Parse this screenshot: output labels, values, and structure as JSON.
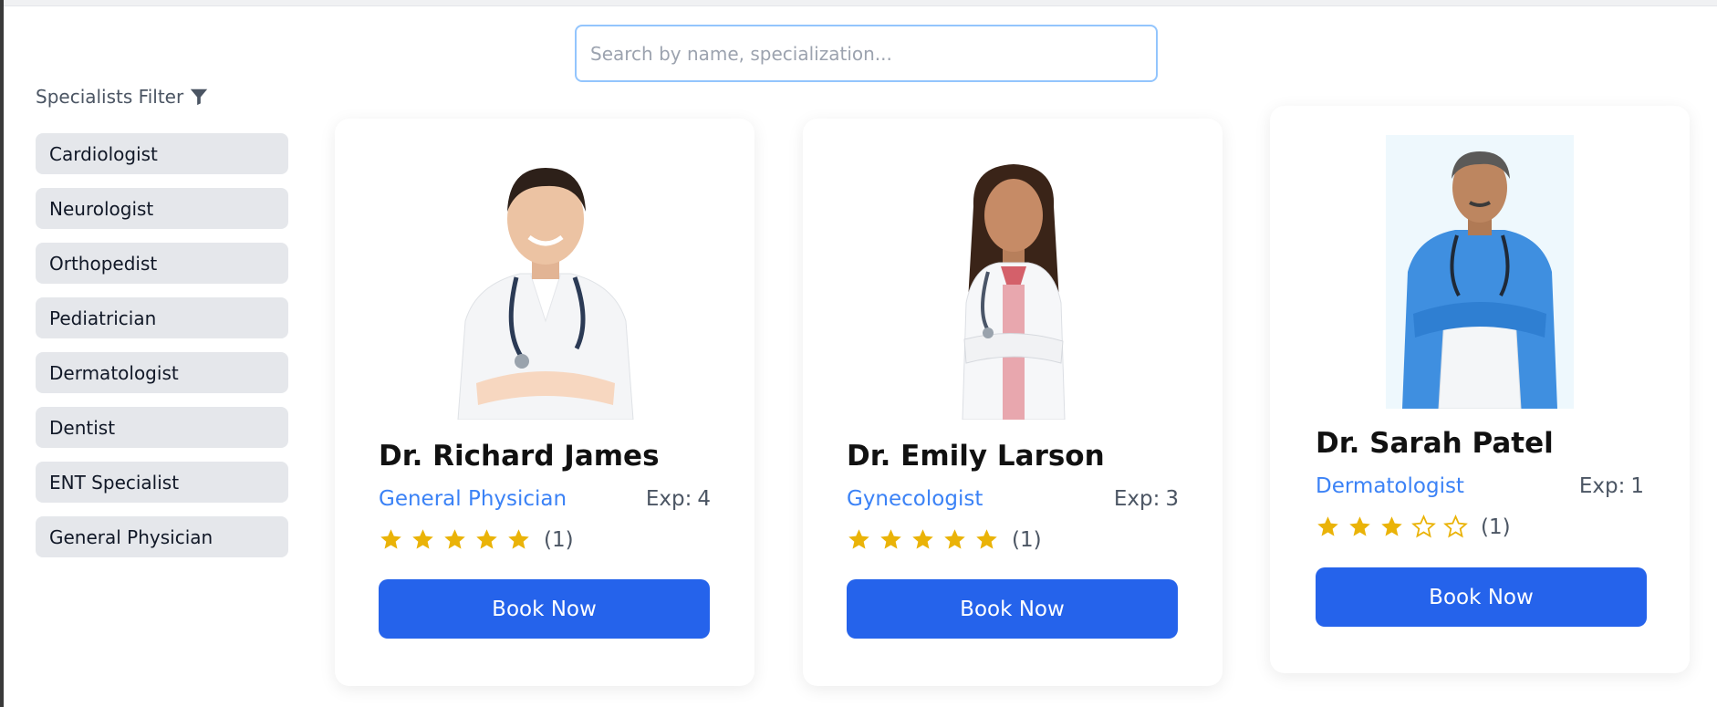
{
  "search": {
    "placeholder": "Search by name, specialization..."
  },
  "filter": {
    "title": "Specialists Filter",
    "items": [
      "Cardiologist",
      "Neurologist",
      "Orthopedist",
      "Pediatrician",
      "Dermatologist",
      "Dentist",
      "ENT Specialist",
      "General Physician"
    ]
  },
  "doctors": [
    {
      "name": "Dr. Richard James",
      "specialization": "General Physician",
      "exp_label": "Exp:",
      "exp_value": "4",
      "rating": 5,
      "rating_count": "(1)",
      "button": "Book Now"
    },
    {
      "name": "Dr. Emily Larson",
      "specialization": "Gynecologist",
      "exp_label": "Exp:",
      "exp_value": "3",
      "rating": 5,
      "rating_count": "(1)",
      "button": "Book Now"
    },
    {
      "name": "Dr. Sarah Patel",
      "specialization": "Dermatologist",
      "exp_label": "Exp:",
      "exp_value": "1",
      "rating": 3,
      "rating_count": "(1)",
      "button": "Book Now"
    }
  ],
  "colors": {
    "accent": "#2563eb",
    "specialization": "#3b82f6",
    "star": "#eab308",
    "filter_bg": "#e5e7eb",
    "search_border": "#93c5fd"
  },
  "icons": {
    "filter": "funnel-icon",
    "star_filled": "star-filled-icon",
    "star_empty": "star-outline-icon",
    "photo": "doctor-photo"
  }
}
